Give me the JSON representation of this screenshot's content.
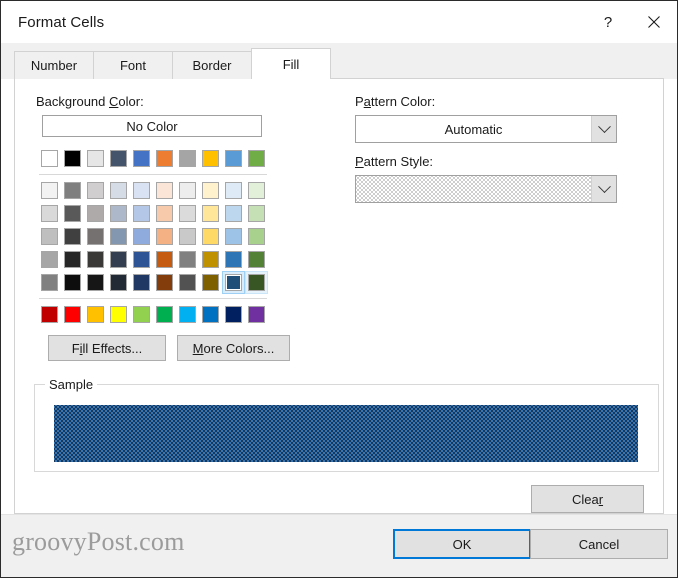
{
  "window": {
    "title": "Format Cells",
    "help_glyph": "?",
    "close_glyph": "✕"
  },
  "tabs": [
    {
      "label": "Number",
      "active": false
    },
    {
      "label": "Font",
      "active": false
    },
    {
      "label": "Border",
      "active": false
    },
    {
      "label": "Fill",
      "active": true
    }
  ],
  "background": {
    "label_before": "Background ",
    "label_accel": "C",
    "label_after": "olor:",
    "no_color_label": "No Color"
  },
  "pattern_color": {
    "label_before": "P",
    "label_accel": "a",
    "label_after": "ttern Color:",
    "value": "Automatic"
  },
  "pattern_style": {
    "label_before": "",
    "label_accel": "P",
    "label_after": "attern Style:",
    "value": "dotted-5-percent"
  },
  "buttons": {
    "fill_effects": {
      "before": "F",
      "accel": "i",
      "after": "ll Effects..."
    },
    "more_colors": {
      "before": "",
      "accel": "M",
      "after": "ore Colors..."
    },
    "clear": {
      "before": "Clea",
      "accel": "r",
      "after": ""
    },
    "ok": "OK",
    "cancel": "Cancel"
  },
  "sample": {
    "title": "Sample",
    "background_color": "#3575b5",
    "pattern_color": "#10233a",
    "pattern": "5-percent-dots"
  },
  "watermark": "groovyPost.com",
  "palette": {
    "theme_header": [
      "#ffffff",
      "#000000",
      "#e7e6e6",
      "#44546a",
      "#4472c4",
      "#ed7d31",
      "#a5a5a5",
      "#ffc000",
      "#5b9bd5",
      "#70ad47"
    ],
    "theme_variants": [
      [
        "#f2f2f2",
        "#7f7f7f",
        "#d0cece",
        "#d6dce5",
        "#d9e2f3",
        "#fbe5d6",
        "#ededed",
        "#fff2cc",
        "#deebf7",
        "#e2efd9"
      ],
      [
        "#d9d9d9",
        "#595959",
        "#aeaaaa",
        "#adb9ca",
        "#b4c7e7",
        "#f7caac",
        "#dbdbdb",
        "#ffe699",
        "#bdd7ee",
        "#c5e0b4"
      ],
      [
        "#bfbfbf",
        "#404040",
        "#757171",
        "#8497b0",
        "#8faadc",
        "#f4b183",
        "#c9c9c9",
        "#ffd966",
        "#9dc3e6",
        "#a9d18e"
      ],
      [
        "#a6a6a6",
        "#262626",
        "#3b3838",
        "#333f50",
        "#2f5496",
        "#c55a11",
        "#808080",
        "#bf9000",
        "#2e75b6",
        "#538135"
      ],
      [
        "#808080",
        "#0d0d0d",
        "#161616",
        "#222a35",
        "#1f3864",
        "#833c0c",
        "#525252",
        "#7f6000",
        "#1f4e79",
        "#375623"
      ]
    ],
    "standard": [
      "#c00000",
      "#ff0000",
      "#ffc000",
      "#ffff00",
      "#92d050",
      "#00b050",
      "#00b0f0",
      "#0070c0",
      "#002060",
      "#7030a0"
    ],
    "selected": {
      "row": 4,
      "col": 8
    },
    "hovered": {
      "row": 4,
      "col": 9
    }
  },
  "colors": {
    "accent": "#0078d7",
    "selection_fill": "#d9ecfb",
    "selection_border": "#9ed0f5"
  }
}
